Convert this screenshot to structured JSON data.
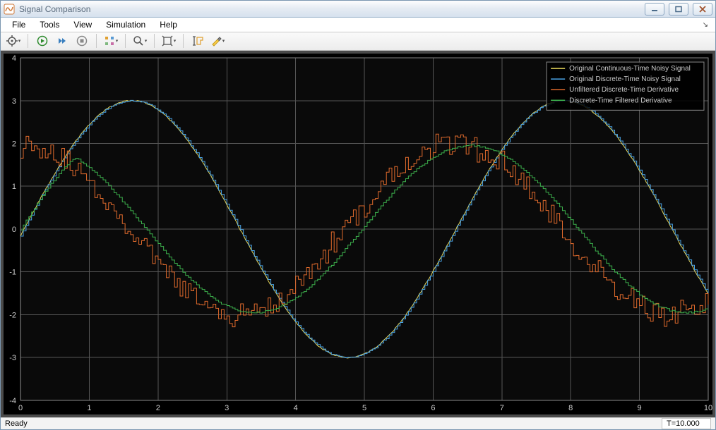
{
  "window": {
    "title": "Signal Comparison"
  },
  "menu": {
    "items": [
      "File",
      "Tools",
      "View",
      "Simulation",
      "Help"
    ]
  },
  "status": {
    "left": "Ready",
    "right": "T=10.000"
  },
  "legend": {
    "items": [
      {
        "label": "Original Continuous-Time Noisy Signal",
        "color": "#e6d75a"
      },
      {
        "label": "Original Discrete-Time Noisy Signal",
        "color": "#4aa3e6"
      },
      {
        "label": "Unfiltered Discrete-Time Derivative",
        "color": "#e06a2c"
      },
      {
        "label": "Discrete-Time Filtered Derivative",
        "color": "#3cb04c"
      }
    ]
  },
  "chart_data": {
    "type": "line",
    "xlabel": "",
    "ylabel": "",
    "xlim": [
      0,
      10
    ],
    "ylim": [
      -4,
      4
    ],
    "xticks": [
      0,
      1,
      2,
      3,
      4,
      5,
      6,
      7,
      8,
      9,
      10
    ],
    "yticks": [
      -4,
      -3,
      -2,
      -1,
      0,
      1,
      2,
      3,
      4
    ],
    "grid": true,
    "legend_pos": "upper-right",
    "series": [
      {
        "name": "Original Continuous-Time Noisy Signal",
        "color": "#e6d75a",
        "formula": "3*sin(x - 0.05) + small_noise",
        "x_range": [
          0,
          10
        ],
        "approx_amplitude": 3.0
      },
      {
        "name": "Original Discrete-Time Noisy Signal",
        "color": "#4aa3e6",
        "formula": "3*sin(x - 0.05) sampled (stairs)",
        "x_range": [
          0,
          10
        ],
        "approx_amplitude": 3.0
      },
      {
        "name": "Unfiltered Discrete-Time Derivative",
        "color": "#e06a2c",
        "formula": "2*cos(x) + heavy_noise (stairs)",
        "x_range": [
          0,
          10
        ],
        "approx_amplitude": 2.0,
        "noise_amplitude": 0.5
      },
      {
        "name": "Discrete-Time Filtered Derivative",
        "color": "#3cb04c",
        "formula": "2*cos(x) filtered, lagged ~0.25 (stairs)",
        "x_range": [
          0,
          10
        ],
        "approx_amplitude": 2.0,
        "start_y": 0.0
      }
    ]
  }
}
